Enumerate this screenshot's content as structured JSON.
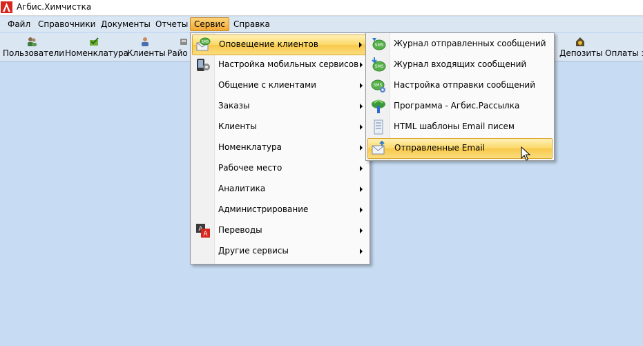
{
  "window": {
    "title": "Агбис.Химчистка"
  },
  "menubar": {
    "items": [
      {
        "label": "Файл"
      },
      {
        "label": "Справочники"
      },
      {
        "label": "Документы"
      },
      {
        "label": "Отчеты"
      },
      {
        "label": "Сервис"
      },
      {
        "label": "Справка"
      }
    ],
    "active_index": 4
  },
  "toolbar": {
    "buttons": [
      {
        "label": "Пользователи",
        "icon": "users-icon"
      },
      {
        "label": "Номенклатура",
        "icon": "nomenclature-icon"
      },
      {
        "label": "Клиенты",
        "icon": "client-icon"
      },
      {
        "label": "Райо",
        "icon": "region-icon"
      },
      {
        "label": "Депозиты",
        "icon": "deposit-icon"
      },
      {
        "label": "Оплаты з",
        "icon": "payment-icon"
      }
    ]
  },
  "service_menu": {
    "items": [
      {
        "label": "Оповещение клиентов",
        "has_submenu": true,
        "icon": "sms-mail-icon",
        "highlighted": true
      },
      {
        "label": "Настройка мобильных сервисов",
        "has_submenu": true,
        "icon": "mobile-settings-icon"
      },
      {
        "label": "Общение с клиентами",
        "has_submenu": true
      },
      {
        "label": "Заказы",
        "has_submenu": true
      },
      {
        "label": "Клиенты",
        "has_submenu": true
      },
      {
        "label": "Номенклатура",
        "has_submenu": true
      },
      {
        "label": "Рабочее место",
        "has_submenu": true
      },
      {
        "label": "Аналитика",
        "has_submenu": true
      },
      {
        "label": "Администрирование",
        "has_submenu": true
      },
      {
        "label": "Переводы",
        "has_submenu": true,
        "icon": "translate-icon"
      },
      {
        "label": "Другие сервисы",
        "has_submenu": true
      }
    ]
  },
  "notify_submenu": {
    "items": [
      {
        "label": "Журнал отправленных сообщений",
        "icon": "sms-sent-icon"
      },
      {
        "label": "Журнал входящих сообщений",
        "icon": "sms-inbox-icon"
      },
      {
        "label": "Настройка отправки сообщений",
        "icon": "sms-settings-icon"
      },
      {
        "label": "Программа - Агбис.Рассылка",
        "icon": "mailing-program-icon"
      },
      {
        "label": "HTML шаблоны Email писем",
        "icon": "html-template-icon"
      },
      {
        "label": "Отправленные Email",
        "icon": "email-sent-icon",
        "highlighted": true
      }
    ]
  },
  "colors": {
    "background": "#c7dcf2",
    "menu_highlight": "#fbd767",
    "active_menu": "#f4a832",
    "logo_red": "#d7261e"
  }
}
